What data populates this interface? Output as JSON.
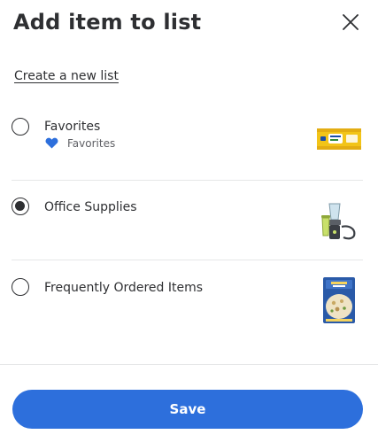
{
  "dialog": {
    "title": "Add item to list",
    "close_icon": "close-icon",
    "create_link": "Create a new list"
  },
  "lists": [
    {
      "label": "Favorites",
      "sublabel": "Favorites",
      "sub_icon": "heart-icon",
      "selected": false
    },
    {
      "label": "Office Supplies",
      "selected": true
    },
    {
      "label": "Frequently Ordered Items",
      "selected": false
    }
  ],
  "footer": {
    "save_label": "Save"
  },
  "colors": {
    "accent": "#2d6fdc",
    "text": "#2e2f32",
    "muted_text": "#5f6065",
    "divider": "#e6e7e8",
    "heart": "#2d6fdc"
  }
}
